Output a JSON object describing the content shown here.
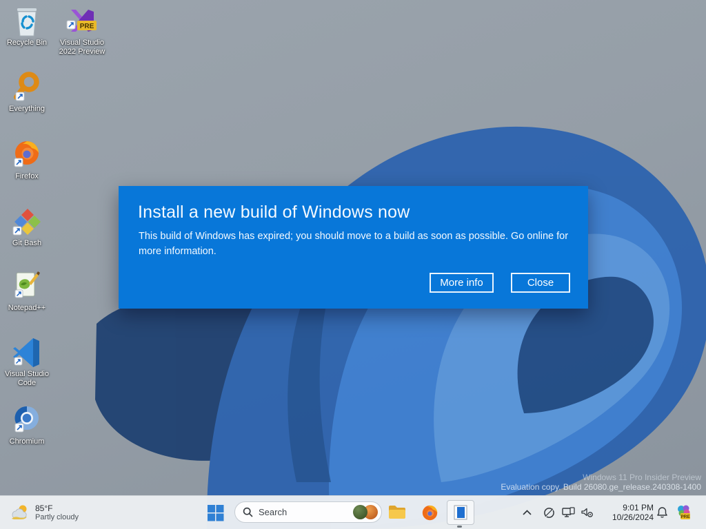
{
  "desktop": {
    "icons": [
      {
        "label": "Recycle Bin"
      },
      {
        "label": "Visual Studio 2022 Preview",
        "badge": "PRE"
      },
      {
        "label": "Everything"
      },
      {
        "label": "Firefox"
      },
      {
        "label": "Git Bash"
      },
      {
        "label": "Notepad++"
      },
      {
        "label": "Visual Studio Code"
      },
      {
        "label": "Chromium"
      }
    ]
  },
  "dialog": {
    "title": "Install a new build of Windows now",
    "body": "This build of Windows has expired; you should move to a build as soon as possible. Go online for more information.",
    "buttons": {
      "more_info": "More info",
      "close": "Close"
    },
    "background": "#0877d9"
  },
  "watermark": {
    "line1": "Windows 11 Pro Insider Preview",
    "line2": "Evaluation copy. Build 26080.ge_release.240308-1400"
  },
  "taskbar": {
    "weather": {
      "temperature": "85°F",
      "condition": "Partly cloudy"
    },
    "search": {
      "placeholder": "Search"
    },
    "clock": {
      "time": "9:01 PM",
      "date": "10/26/2024"
    },
    "tray": {
      "pre_badge": "PRE"
    }
  },
  "colors": {
    "dialog_blue": "#0877d9",
    "taskbar_bg": "#ebeef2",
    "accent_blue": "#2f80d4"
  }
}
